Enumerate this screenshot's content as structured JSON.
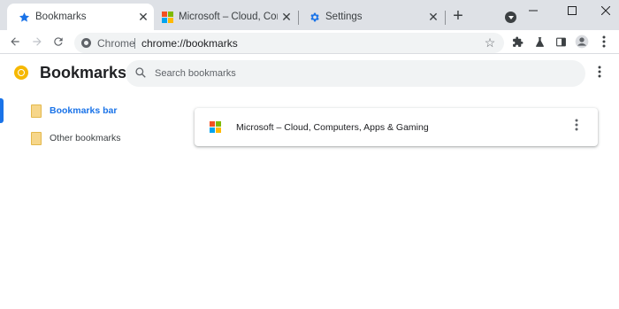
{
  "tabs": [
    {
      "title": "Bookmarks",
      "icon": "star-icon",
      "active": true
    },
    {
      "title": "Microsoft – Cloud, Compute",
      "icon": "microsoft-logo-icon",
      "active": false
    },
    {
      "title": "Settings",
      "icon": "gear-icon",
      "active": false
    }
  ],
  "omnibox": {
    "chip": "Chrome",
    "url": "chrome://bookmarks"
  },
  "bookmarks_page": {
    "title": "Bookmarks",
    "search_placeholder": "Search bookmarks"
  },
  "sidebar": {
    "items": [
      {
        "label": "Bookmarks bar",
        "selected": true
      },
      {
        "label": "Other bookmarks",
        "selected": false
      }
    ]
  },
  "bookmark_list": [
    {
      "title": "Microsoft – Cloud, Computers, Apps & Gaming",
      "icon": "microsoft-logo-icon"
    }
  ],
  "colors": {
    "accent": "#1a73e8",
    "tabstrip": "#dee1e6",
    "omnibox": "#f1f3f4",
    "folder": "#f6d68a",
    "ms_red": "#f25022",
    "ms_green": "#7fba00",
    "ms_blue": "#00a4ef",
    "ms_yellow": "#ffb900"
  }
}
